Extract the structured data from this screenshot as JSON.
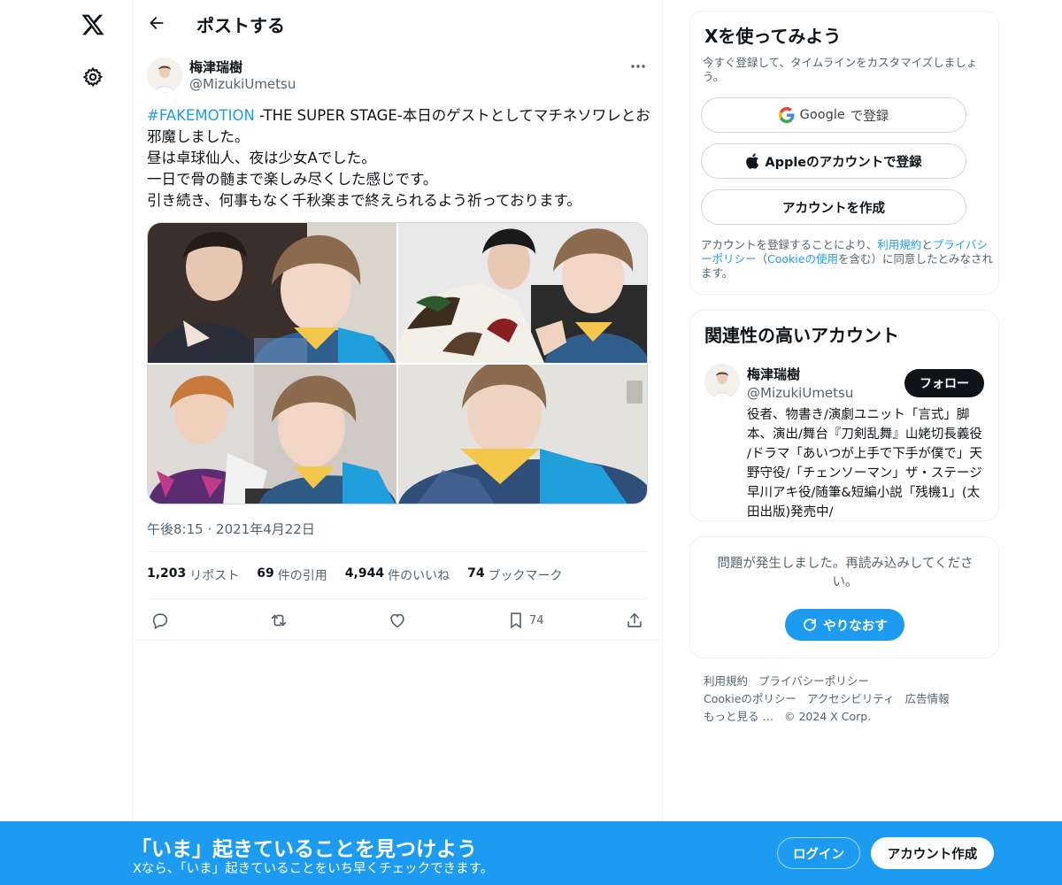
{
  "header": {
    "title": "ポストする"
  },
  "post": {
    "author_name": "梅津瑞樹",
    "author_handle": "@MizukiUmetsu",
    "hashtag": "#FAKEMOTION",
    "text_line1_rest": " -THE SUPER STAGE-本日のゲストとしてマチネソワレとお",
    "text_line2": "邪魔しました。",
    "text_line3": "昼は卓球仙人、夜は少女Aでした。",
    "text_line4": "一日で骨の髄まで楽しみ尽くした感じです。",
    "text_line5": "引き続き、何事もなく千秋楽まで終えられるよう祈っております。",
    "time": "午後8:15",
    "separator": "·",
    "date": "2021年4月22日",
    "stats": [
      {
        "count": "1,203",
        "label": "リポスト"
      },
      {
        "count": "69",
        "label": "件の引用"
      },
      {
        "count": "4,944",
        "label": "件のいいね"
      },
      {
        "count": "74",
        "label": "ブックマーク"
      }
    ],
    "bookmark_count": "74"
  },
  "signup": {
    "title": "Xを使ってみよう",
    "subtitle": "今すぐ登録して、タイムラインをカスタマイズしましょう。",
    "google_label": "Google",
    "google_suffix": "で登録",
    "apple_label": "Appleのアカウントで登録",
    "create_label": "アカウントを作成",
    "terms_prefix": "アカウントを登録することにより、",
    "terms_link1": "利用規約",
    "terms_and": "と",
    "terms_link2": "プライバシーポリシー",
    "terms_paren_open": "（",
    "terms_link3": "Cookieの使用",
    "terms_suffix": "を含む）に同意したとみなされます。"
  },
  "related": {
    "title": "関連性の高いアカウント",
    "name": "梅津瑞樹",
    "handle": "@MizukiUmetsu",
    "follow_label": "フォロー",
    "bio": "役者、物書き/演劇ユニット「言式」脚本、演出/舞台『刀剣乱舞』山姥切長義役 /ドラマ「あいつが上手で下手が僕で」天野守役/「チェンソーマン」ザ・ステージ 早川アキ役/随筆&短編小説「残機1」(太田出版)発売中/"
  },
  "error": {
    "message": "問題が発生しました。再読み込みしてください。",
    "retry_label": "やりなおす"
  },
  "footer": {
    "links_row1": [
      "利用規約",
      "プライバシーポリシー"
    ],
    "links_row2": [
      "Cookieのポリシー",
      "アクセシビリティ",
      "広告情報"
    ],
    "more": "もっと見る …",
    "copyright": "© 2024 X Corp."
  },
  "bottom_bar": {
    "title": "「いま」起きていることを見つけよう",
    "subtitle": "Xなら、「いま」起きていることをいち早くチェックできます。",
    "login_label": "ログイン",
    "signup_label": "アカウント作成"
  },
  "colors": {
    "accent": "#1d9bf0",
    "text_primary": "#0f1419",
    "text_secondary": "#536471",
    "border": "#eff3f4"
  }
}
